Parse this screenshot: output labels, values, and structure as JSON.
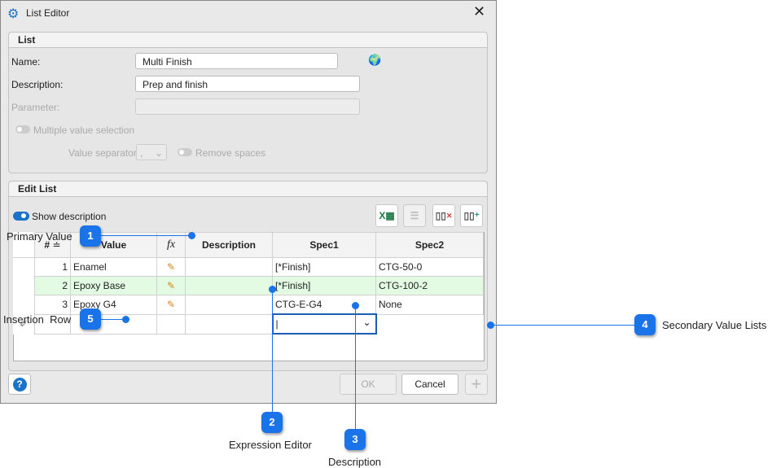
{
  "window": {
    "title": "List Editor",
    "icon": "gear-icon"
  },
  "list_group": {
    "title": "List",
    "name_label": "Name:",
    "name_value": "Multi Finish",
    "description_label": "Description:",
    "description_value": "Prep and finish",
    "parameter_label": "Parameter:",
    "parameter_value": "",
    "multiple_label": "Multiple value selection",
    "multiple_on": false,
    "separator_label": "Value separator",
    "separator_value": ",",
    "remove_spaces_label": "Remove spaces",
    "remove_spaces_on": false
  },
  "edit_group": {
    "title": "Edit List",
    "show_description_label": "Show description",
    "show_description_on": true,
    "toolbar": [
      "excel-icon",
      "remove-row-icon",
      "delete-column-icon",
      "add-column-icon"
    ],
    "columns": [
      "#",
      "Value",
      "fx",
      "Description",
      "Spec1",
      "Spec2"
    ],
    "rows": [
      {
        "n": "1",
        "value": "Enamel",
        "description": "",
        "spec1": "[*Finish]",
        "spec2": "CTG-50-0"
      },
      {
        "n": "2",
        "value": "Epoxy Base",
        "description": "",
        "spec1": "[*Finish]",
        "spec2": "CTG-100-2"
      },
      {
        "n": "3",
        "value": "Epoxy G4",
        "description": "",
        "spec1": "CTG-E-G4",
        "spec2": "None"
      }
    ],
    "insert_spec1": ""
  },
  "buttons": {
    "help": "?",
    "ok": "OK",
    "cancel": "Cancel",
    "add": "+"
  },
  "callouts": [
    {
      "n": "1",
      "label": "Primary Value"
    },
    {
      "n": "2",
      "label": "Expression Editor"
    },
    {
      "n": "3",
      "label": "Description"
    },
    {
      "n": "4",
      "label": "Secondary Value Lists"
    },
    {
      "n": "5",
      "label": "Insertion  Row"
    }
  ],
  "colors": {
    "accent": "#1a73e8",
    "selected_row": "#e3fbe3"
  }
}
